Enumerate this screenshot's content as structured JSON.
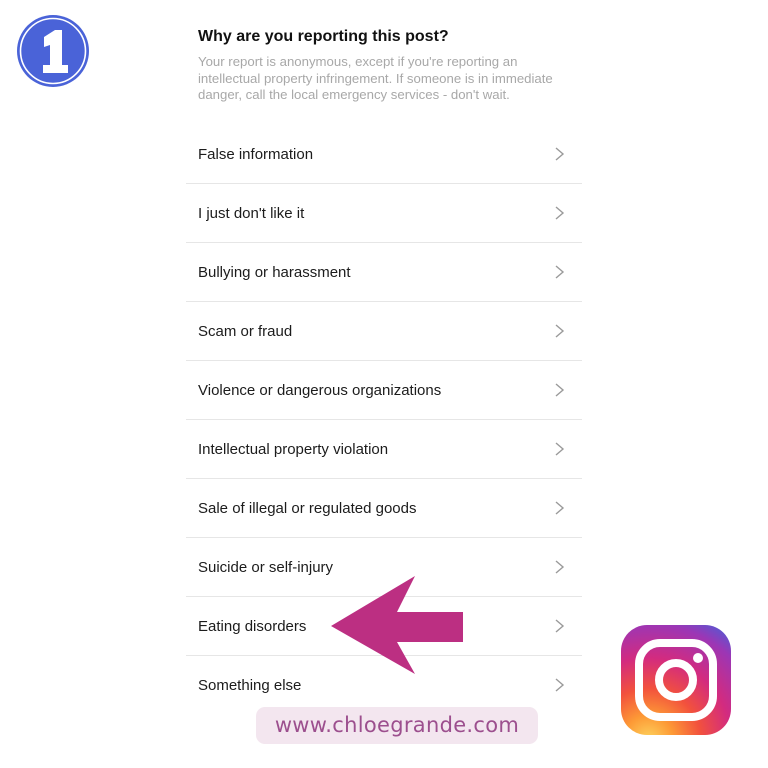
{
  "step": {
    "number": "1",
    "color": "#4a63d8"
  },
  "dialog": {
    "title": "Why are you reporting this post?",
    "subtitle": "Your report is anonymous, except if you're reporting an intellectual property infringement. If someone is in immediate danger, call the local emergency services - don't wait.",
    "options": [
      {
        "label": "False information"
      },
      {
        "label": "I just don't like it"
      },
      {
        "label": "Bullying or harassment"
      },
      {
        "label": "Scam or fraud"
      },
      {
        "label": "Violence or dangerous organizations"
      },
      {
        "label": "Intellectual property violation"
      },
      {
        "label": "Sale of illegal or regulated goods"
      },
      {
        "label": "Suicide or self-injury"
      },
      {
        "label": "Eating disorders"
      },
      {
        "label": "Something else"
      }
    ],
    "highlighted_option": "Eating disorders"
  },
  "annotation": {
    "arrow_color": "#bc2f82",
    "arrow_direction": "left"
  },
  "branding": {
    "logo": "instagram-logo",
    "website": "www.chloegrande.com",
    "website_color": "#9c4f8e",
    "pill_color": "#f3e6ef"
  }
}
